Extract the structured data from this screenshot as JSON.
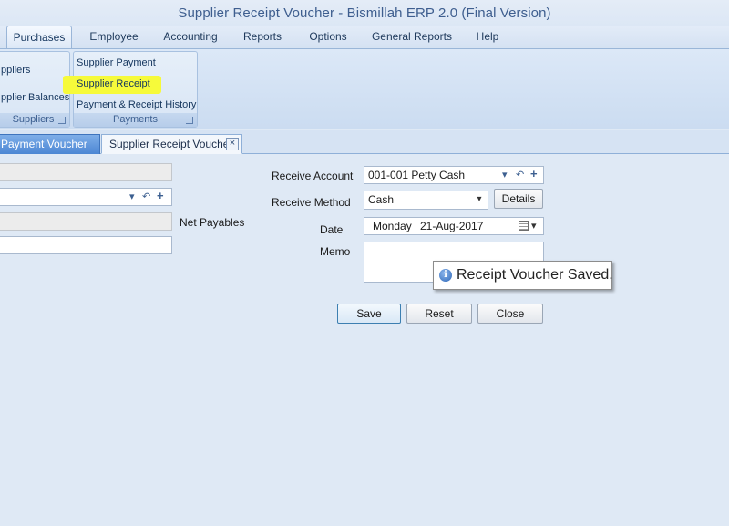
{
  "window": {
    "title": "Supplier Receipt Voucher - Bismillah ERP 2.0  (Final Version)"
  },
  "menu": {
    "tabs": [
      "Purchases",
      "Employee",
      "Accounting",
      "Reports",
      "Options",
      "General Reports",
      "Help"
    ],
    "active": "Purchases"
  },
  "ribbon": {
    "suppliers_group": {
      "items": [
        "ppliers",
        "pplier Balances"
      ],
      "caption": "Suppliers"
    },
    "payments_group": {
      "items": [
        "Supplier Payment",
        "Supplier Receipt",
        "Payment & Receipt History"
      ],
      "caption": "Payments",
      "highlighted_item": "Supplier Receipt",
      "highlight_color": "#f6fa3a"
    }
  },
  "doc_tabs": {
    "inactive": "Payment Voucher",
    "active": "Supplier Receipt Voucher",
    "close_glyph": "×"
  },
  "form_left": {
    "net_payables_label": "Net Payables"
  },
  "form_right": {
    "receive_account_label": "Receive Account",
    "receive_account_value": "001-001 Petty Cash",
    "receive_method_label": "Receive Method",
    "receive_method_value": "Cash",
    "details_button": "Details",
    "date_label": "Date",
    "date_day": "Monday",
    "date_value": "21-Aug-2017",
    "memo_label": "Memo",
    "memo_value": ""
  },
  "buttons": {
    "save": "Save",
    "reset": "Reset",
    "close": "Close"
  },
  "tooltip": {
    "message": "Receipt Voucher Saved.",
    "icon": "info-icon"
  },
  "icons": {
    "dropdown": "▾",
    "undo": "↶",
    "add": "+",
    "info": "i"
  }
}
